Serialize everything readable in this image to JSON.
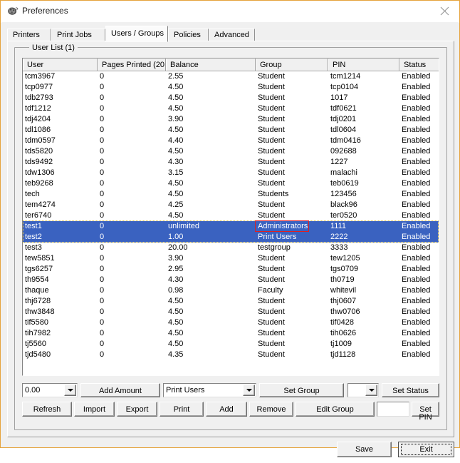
{
  "window": {
    "title": "Preferences",
    "icon": "printer-app-icon",
    "close_icon": "close-icon",
    "border_color": "#e5a33c"
  },
  "tabs": [
    {
      "label": "Printers",
      "active": false
    },
    {
      "label": "Print Jobs",
      "active": false
    },
    {
      "label": "Users / Groups",
      "active": true
    },
    {
      "label": "Policies",
      "active": false
    },
    {
      "label": "Advanced",
      "active": false
    }
  ],
  "group": {
    "label": "User List (1)"
  },
  "table": {
    "columns": [
      "User",
      "Pages Printed (20...",
      "Balance",
      "Group",
      "PIN",
      "Status"
    ],
    "selection_color": "#3a62c0",
    "highlight_color": "#e02020",
    "rows": [
      {
        "user": "tcm3967",
        "pages": "0",
        "balance": "2.55",
        "group": "Student",
        "pin": "tcm1214",
        "status": "Enabled",
        "selected": false
      },
      {
        "user": "tcp0977",
        "pages": "0",
        "balance": "4.50",
        "group": "Student",
        "pin": "tcp0104",
        "status": "Enabled",
        "selected": false
      },
      {
        "user": "tdb2793",
        "pages": "0",
        "balance": "4.50",
        "group": "Student",
        "pin": "1017",
        "status": "Enabled",
        "selected": false
      },
      {
        "user": "tdf1212",
        "pages": "0",
        "balance": "4.50",
        "group": "Student",
        "pin": "tdf0621",
        "status": "Enabled",
        "selected": false
      },
      {
        "user": "tdj4204",
        "pages": "0",
        "balance": "3.90",
        "group": "Student",
        "pin": "tdj0201",
        "status": "Enabled",
        "selected": false
      },
      {
        "user": "tdl1086",
        "pages": "0",
        "balance": "4.50",
        "group": "Student",
        "pin": "tdl0604",
        "status": "Enabled",
        "selected": false
      },
      {
        "user": "tdm0597",
        "pages": "0",
        "balance": "4.40",
        "group": "Student",
        "pin": "tdm0416",
        "status": "Enabled",
        "selected": false
      },
      {
        "user": "tds5820",
        "pages": "0",
        "balance": "4.50",
        "group": "Student",
        "pin": "092688",
        "status": "Enabled",
        "selected": false
      },
      {
        "user": "tds9492",
        "pages": "0",
        "balance": "4.30",
        "group": "Student",
        "pin": "1227",
        "status": "Enabled",
        "selected": false
      },
      {
        "user": "tdw1306",
        "pages": "0",
        "balance": "3.15",
        "group": "Student",
        "pin": "malachi",
        "status": "Enabled",
        "selected": false
      },
      {
        "user": "teb9268",
        "pages": "0",
        "balance": "4.50",
        "group": "Student",
        "pin": "teb0619",
        "status": "Enabled",
        "selected": false
      },
      {
        "user": "tech",
        "pages": "0",
        "balance": "4.50",
        "group": "Students",
        "pin": "123456",
        "status": "Enabled",
        "selected": false
      },
      {
        "user": "tem4274",
        "pages": "0",
        "balance": "4.25",
        "group": "Student",
        "pin": "black96",
        "status": "Enabled",
        "selected": false
      },
      {
        "user": "ter6740",
        "pages": "0",
        "balance": "4.50",
        "group": "Student",
        "pin": "ter0520",
        "status": "Enabled",
        "selected": false
      },
      {
        "user": "test1",
        "pages": "0",
        "balance": "unlimited",
        "group": "Administrators",
        "pin": "1111",
        "status": "Enabled",
        "selected": true
      },
      {
        "user": "test2",
        "pages": "0",
        "balance": "1.00",
        "group": "Print Users",
        "pin": "2222",
        "status": "Enabled",
        "selected": true
      },
      {
        "user": "test3",
        "pages": "0",
        "balance": "20.00",
        "group": "testgroup",
        "pin": "3333",
        "status": "Enabled",
        "selected": false
      },
      {
        "user": "tew5851",
        "pages": "0",
        "balance": "3.90",
        "group": "Student",
        "pin": "tew1205",
        "status": "Enabled",
        "selected": false
      },
      {
        "user": "tgs6257",
        "pages": "0",
        "balance": "2.95",
        "group": "Student",
        "pin": "tgs0709",
        "status": "Enabled",
        "selected": false
      },
      {
        "user": "th9554",
        "pages": "0",
        "balance": "4.30",
        "group": "Student",
        "pin": "th0719",
        "status": "Enabled",
        "selected": false
      },
      {
        "user": "thaque",
        "pages": "0",
        "balance": "0.98",
        "group": "Faculty",
        "pin": "whitevil",
        "status": "Enabled",
        "selected": false
      },
      {
        "user": "thj6728",
        "pages": "0",
        "balance": "4.50",
        "group": "Student",
        "pin": "thj0607",
        "status": "Enabled",
        "selected": false
      },
      {
        "user": "thw3848",
        "pages": "0",
        "balance": "4.50",
        "group": "Student",
        "pin": "thw0706",
        "status": "Enabled",
        "selected": false
      },
      {
        "user": "tif5580",
        "pages": "0",
        "balance": "4.50",
        "group": "Student",
        "pin": "tif0428",
        "status": "Enabled",
        "selected": false
      },
      {
        "user": "tih7982",
        "pages": "0",
        "balance": "4.50",
        "group": "Student",
        "pin": "tih0626",
        "status": "Enabled",
        "selected": false
      },
      {
        "user": "tj5560",
        "pages": "0",
        "balance": "4.50",
        "group": "Student",
        "pin": "tj1009",
        "status": "Enabled",
        "selected": false
      },
      {
        "user": "tjd5480",
        "pages": "0",
        "balance": "4.35",
        "group": "Student",
        "pin": "tjd1128",
        "status": "Enabled",
        "selected": false
      }
    ]
  },
  "controls": {
    "amount_combo_value": "0.00",
    "add_amount_label": "Add Amount",
    "group_combo_value": "Print Users",
    "set_group_label": "Set Group",
    "status_combo_value": "",
    "set_status_label": "Set Status",
    "refresh_label": "Refresh",
    "import_label": "Import",
    "export_label": "Export",
    "print_label": "Print",
    "add_label": "Add",
    "remove_label": "Remove",
    "edit_group_label": "Edit Group",
    "pin_textbox_value": "",
    "set_pin_label": "Set PIN"
  },
  "footer": {
    "save_label": "Save",
    "exit_label": "Exit"
  }
}
